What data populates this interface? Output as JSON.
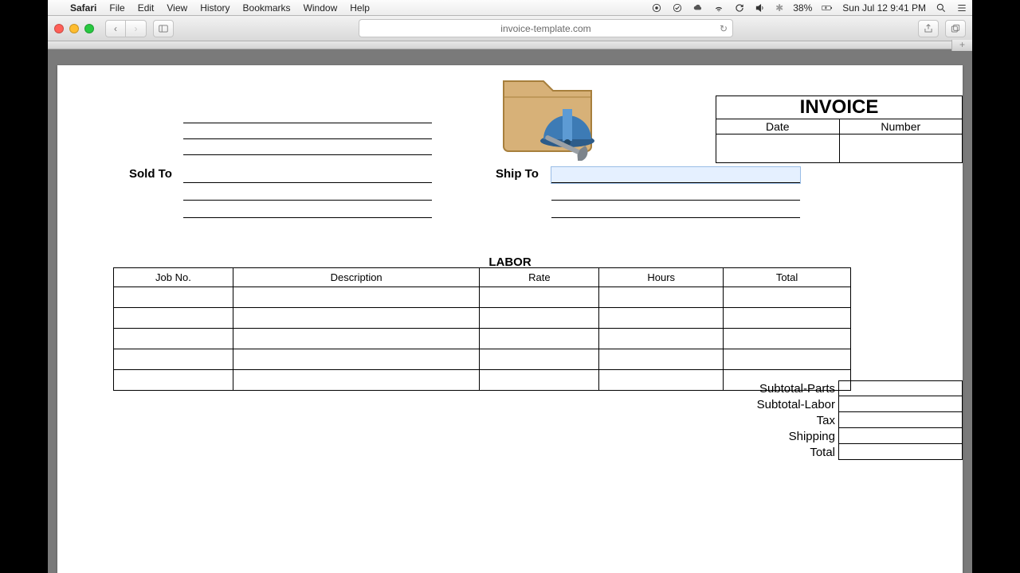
{
  "menubar": {
    "app": "Safari",
    "items": [
      "File",
      "Edit",
      "View",
      "History",
      "Bookmarks",
      "Window",
      "Help"
    ],
    "battery": "38%",
    "clock": "Sun Jul 12  9:41 PM"
  },
  "toolbar": {
    "url": "invoice-template.com",
    "new_tab": "+"
  },
  "invoice": {
    "title": "INVOICE",
    "headers": {
      "date": "Date",
      "number": "Number"
    },
    "date": "",
    "number": "",
    "sold_to_label": "Sold To",
    "ship_to_label": "Ship To",
    "sold_to": [
      "",
      "",
      ""
    ],
    "ship_to": [
      "",
      "",
      ""
    ],
    "company_lines": [
      "",
      "",
      ""
    ]
  },
  "labor": {
    "section": "LABOR",
    "cols": {
      "job": "Job No.",
      "desc": "Description",
      "rate": "Rate",
      "hours": "Hours",
      "total": "Total"
    },
    "rows": [
      {
        "job": "",
        "desc": "",
        "rate": "",
        "hours": "",
        "total": ""
      },
      {
        "job": "",
        "desc": "",
        "rate": "",
        "hours": "",
        "total": ""
      },
      {
        "job": "",
        "desc": "",
        "rate": "",
        "hours": "",
        "total": ""
      },
      {
        "job": "",
        "desc": "",
        "rate": "",
        "hours": "",
        "total": ""
      },
      {
        "job": "",
        "desc": "",
        "rate": "",
        "hours": "",
        "total": ""
      }
    ]
  },
  "totals": {
    "subtotal_parts": {
      "label": "Subtotal-Parts",
      "value": ""
    },
    "subtotal_labor": {
      "label": "Subtotal-Labor",
      "value": ""
    },
    "tax": {
      "label": "Tax",
      "value": ""
    },
    "shipping": {
      "label": "Shipping",
      "value": ""
    },
    "total": {
      "label": "Total",
      "value": ""
    }
  }
}
